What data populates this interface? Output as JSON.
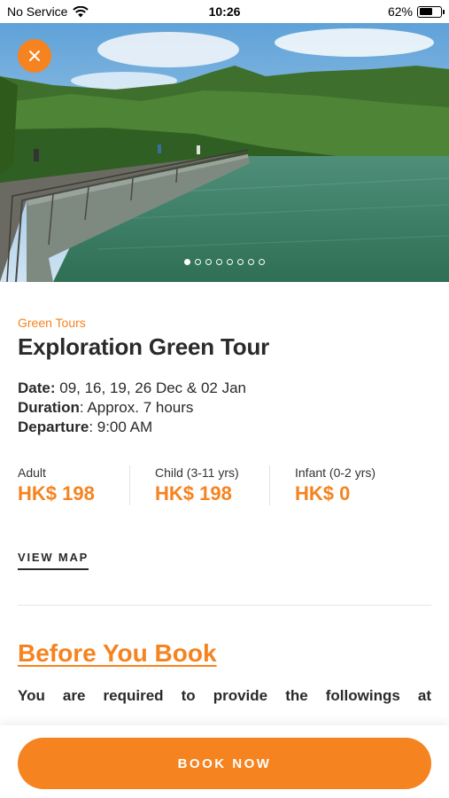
{
  "status_bar": {
    "carrier": "No Service",
    "time": "10:26",
    "battery_percent": "62%",
    "battery_level": 0.62
  },
  "hero": {
    "image_count": 8,
    "active_index": 0,
    "close_icon": "close-icon"
  },
  "tour": {
    "category": "Green Tours",
    "title": "Exploration Green Tour",
    "details": [
      {
        "label": "Date:",
        "value": " 09, 16, 19, 26 Dec & 02 Jan"
      },
      {
        "label": "Duration",
        "value": ": Approx. 7 hours"
      },
      {
        "label": "Departure",
        "value": ": 9:00 AM"
      }
    ],
    "prices": [
      {
        "label": "Adult",
        "value": "HK$ 198"
      },
      {
        "label": "Child (3-11 yrs)",
        "value": "HK$ 198"
      },
      {
        "label": "Infant (0-2 yrs)",
        "value": "HK$ 0"
      }
    ],
    "view_map": "VIEW MAP"
  },
  "before_you_book": {
    "title": "Before You Book",
    "text": "You are required to provide the followings at"
  },
  "book_button": "BOOK NOW",
  "colors": {
    "accent": "#f5831f",
    "text": "#2a2a2a"
  }
}
